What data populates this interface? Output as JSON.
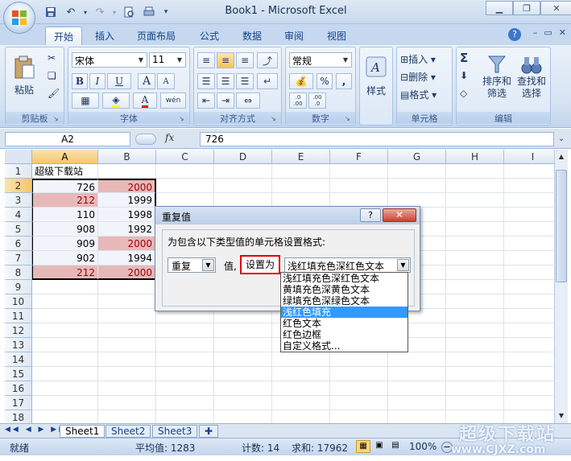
{
  "app": {
    "title": "Book1 - Microsoft Excel"
  },
  "ribbon_tabs": [
    "开始",
    "插入",
    "页面布局",
    "公式",
    "数据",
    "审阅",
    "视图"
  ],
  "ribbon": {
    "clipboard": {
      "label": "剪贴板",
      "paste": "粘贴"
    },
    "font": {
      "label": "字体",
      "name": "宋体",
      "size": "11",
      "bold": "B",
      "italic": "I",
      "underline": "U",
      "grow": "A",
      "shrink": "A",
      "wen": "wén"
    },
    "alignment": {
      "label": "对齐方式"
    },
    "number": {
      "label": "数字",
      "format": "常规",
      "percent": "%",
      "comma": ",",
      "inc": ".0 .00",
      "dec": ".00 .0"
    },
    "styles": {
      "label": "样式"
    },
    "cells": {
      "label": "单元格",
      "insert": "插入",
      "delete": "删除",
      "format": "格式"
    },
    "editing": {
      "label": "编辑",
      "sort_filter_1": "排序和",
      "sort_filter_2": "筛选",
      "find_1": "查找和",
      "find_2": "选择",
      "sigma": "Σ"
    }
  },
  "formula_bar": {
    "name_box": "A2",
    "fx": "fx",
    "value": "726"
  },
  "columns": [
    "A",
    "B",
    "C",
    "D",
    "E",
    "F",
    "G",
    "H",
    "I"
  ],
  "rows": [
    "1",
    "2",
    "3",
    "4",
    "5",
    "6",
    "7",
    "8",
    "9",
    "10",
    "11",
    "12",
    "13",
    "14",
    "15",
    "16",
    "17",
    "18"
  ],
  "cells": {
    "A1": "超级下载站",
    "A2": "726",
    "B2": "2000",
    "A3": "212",
    "B3": "1999",
    "A4": "110",
    "B4": "1998",
    "A5": "908",
    "B5": "1992",
    "A6": "909",
    "B6": "2000",
    "A7": "902",
    "B7": "1994",
    "A8": "212",
    "B8": "2000"
  },
  "colors": {
    "dup_fill": "#e6b9b8",
    "dup_text": "#9c0006",
    "accent": "#15428b"
  },
  "dialog": {
    "title": "重复值",
    "help": "?",
    "close": "✕",
    "prompt": "为包含以下类型值的单元格设置格式:",
    "type_value": "重复",
    "val_label": "值,",
    "set_as": "设置为",
    "format_value": "浅红填充色深红色文本"
  },
  "dropdown_options": [
    "浅红填充色深红色文本",
    "黄填充色深黄色文本",
    "绿填充色深绿色文本",
    "浅红色填充",
    "红色文本",
    "红色边框",
    "自定义格式..."
  ],
  "sheets": [
    "Sheet1",
    "Sheet2",
    "Sheet3"
  ],
  "status": {
    "ready": "就绪",
    "average": "平均值: 1283",
    "count": "计数: 14",
    "sum": "求和: 17962",
    "zoom": "100%"
  },
  "watermark": {
    "brand": "超级下载站",
    "url": "www.CJXZ.com"
  }
}
